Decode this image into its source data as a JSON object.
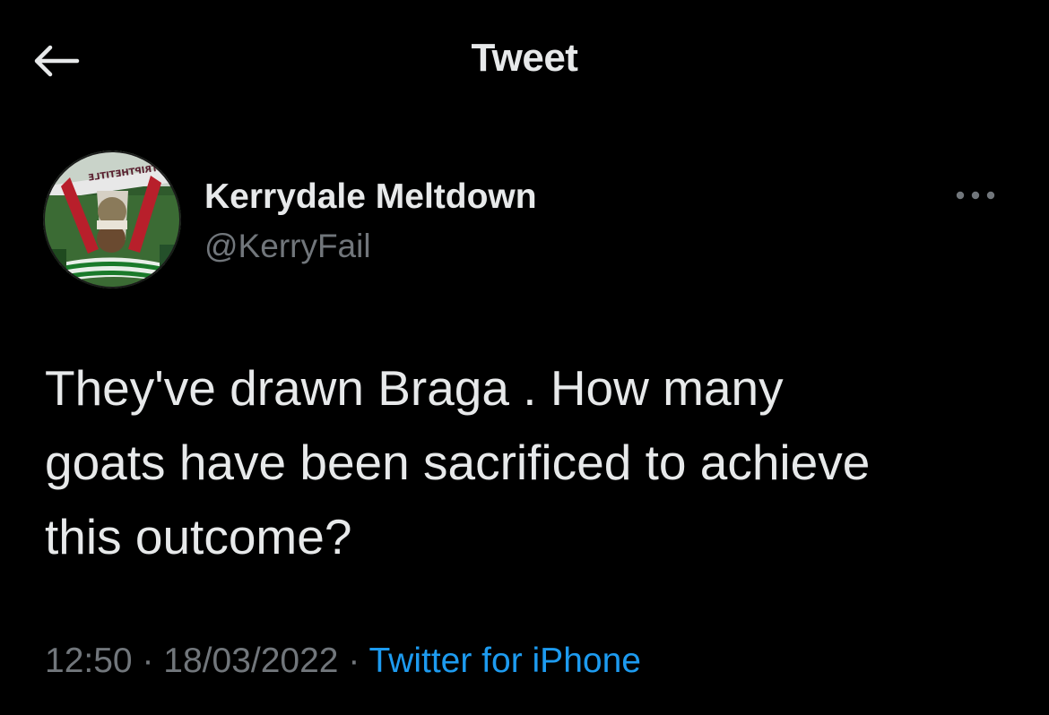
{
  "header": {
    "title": "Tweet",
    "back_icon": "arrow-left-icon"
  },
  "author": {
    "name": "Kerrydale Meltdown",
    "handle": "@KerryFail",
    "avatar_banner_text": "STRIPTHETITLE"
  },
  "more_icon": "ellipsis-icon",
  "tweet": {
    "text": "They've drawn Braga . How many\ngoats have been sacrificed to achieve\nthis outcome?",
    "time": "12:50",
    "separator": "·",
    "date": "18/03/2022",
    "source": "Twitter for iPhone"
  },
  "colors": {
    "background": "#000000",
    "primary_text": "#e7e9ea",
    "secondary_text": "#71767b",
    "link": "#1d9bf0"
  }
}
